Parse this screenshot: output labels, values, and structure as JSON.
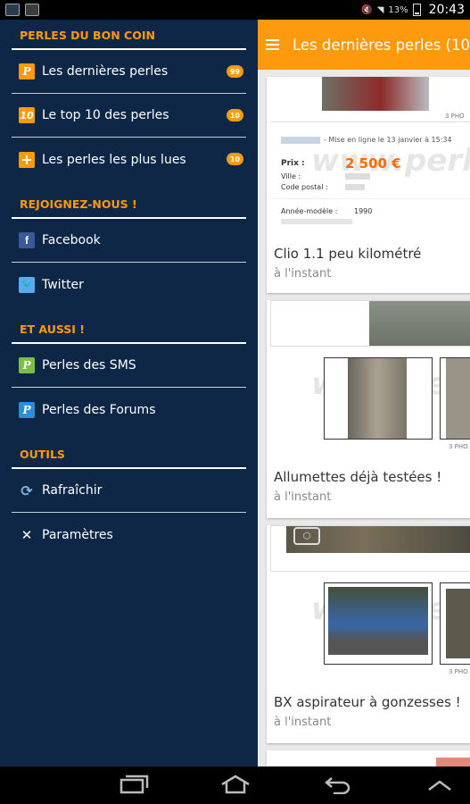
{
  "status_bar": {
    "battery": "13%",
    "time": "20:43"
  },
  "main": {
    "title": "Les dernières perles (10",
    "cards": [
      {
        "title": "Clio 1.1 peu kilométré",
        "time": "à l'instant",
        "photos_label": "3 PHO",
        "listing": {
          "meta": "- Mise en ligne le 13 janvier à 15:34",
          "price_label": "Prix :",
          "price": "2 500 €",
          "city_label": "Ville :",
          "postal_label": "Code postal :",
          "year_label": "Année-modèle :",
          "year": "1990"
        }
      },
      {
        "title": "Allumettes déjà testées !",
        "time": "à l'instant",
        "photos_label": "3 PHO"
      },
      {
        "title": "BX aspirateur à gonzesses !",
        "time": "à l'instant",
        "photos_label": "3 PHO"
      }
    ],
    "watermark": "www.perles"
  },
  "drawer": {
    "sections": [
      {
        "header": "PERLES DU BON COIN",
        "items": [
          {
            "label": "Les dernières perles",
            "icon": "perle-icon",
            "badge": "99"
          },
          {
            "label": "Le top 10 des perles",
            "icon": "top10-icon",
            "badge": "10"
          },
          {
            "label": "Les perles les plus lues",
            "icon": "plus-icon",
            "badge": "10"
          }
        ]
      },
      {
        "header": "REJOIGNEZ-NOUS !",
        "items": [
          {
            "label": "Facebook",
            "icon": "facebook-icon"
          },
          {
            "label": "Twitter",
            "icon": "twitter-icon"
          }
        ]
      },
      {
        "header": "ET AUSSI !",
        "items": [
          {
            "label": "Perles des SMS",
            "icon": "sms-perle-icon"
          },
          {
            "label": "Perles des Forums",
            "icon": "forum-perle-icon"
          }
        ]
      },
      {
        "header": "OUTILS",
        "items": [
          {
            "label": "Rafraîchir",
            "icon": "refresh-icon"
          },
          {
            "label": "Paramètres",
            "icon": "tools-icon"
          }
        ]
      }
    ]
  },
  "colors": {
    "accent": "#ff9a0e",
    "drawer_bg": "#0e2747",
    "facebook": "#3b5998",
    "twitter": "#55acee",
    "sms": "#7ac143"
  }
}
